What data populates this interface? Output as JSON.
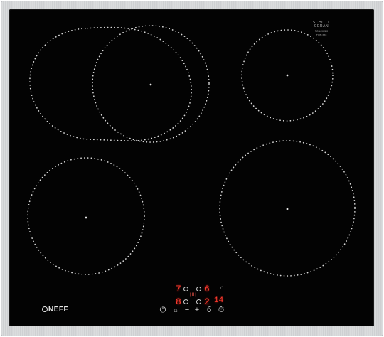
{
  "device": {
    "brand": "NEFF",
    "badge": {
      "line1": "SCHOTT",
      "line2": "CERAN",
      "line3": "TOUCH 5.0",
      "line4": "TYPE XXX"
    }
  },
  "zones": [
    {
      "id": "rear-left",
      "shape": "oval"
    },
    {
      "id": "rear-right",
      "shape": "circle"
    },
    {
      "id": "front-left",
      "shape": "circle"
    },
    {
      "id": "front-right",
      "shape": "circle"
    }
  ],
  "control_panel": {
    "displays": {
      "rear_left": "7",
      "rear_right": "6",
      "front_left": "8",
      "front_right": "2",
      "front_right_small": "14",
      "hob_marker": "|H|"
    },
    "buttons": {
      "power_symbol": "⏻",
      "wipe_symbol": "⌂",
      "minus_symbol": "−",
      "plus_symbol": "+",
      "boost_symbol": "б",
      "timer_symbol": "⏱",
      "lock_symbol": "⌂"
    }
  },
  "colors": {
    "glass": "#030303",
    "frame": "#cfd0d2",
    "zone_dots": "#d8d8d8",
    "display_red": "#ff3b2f"
  }
}
